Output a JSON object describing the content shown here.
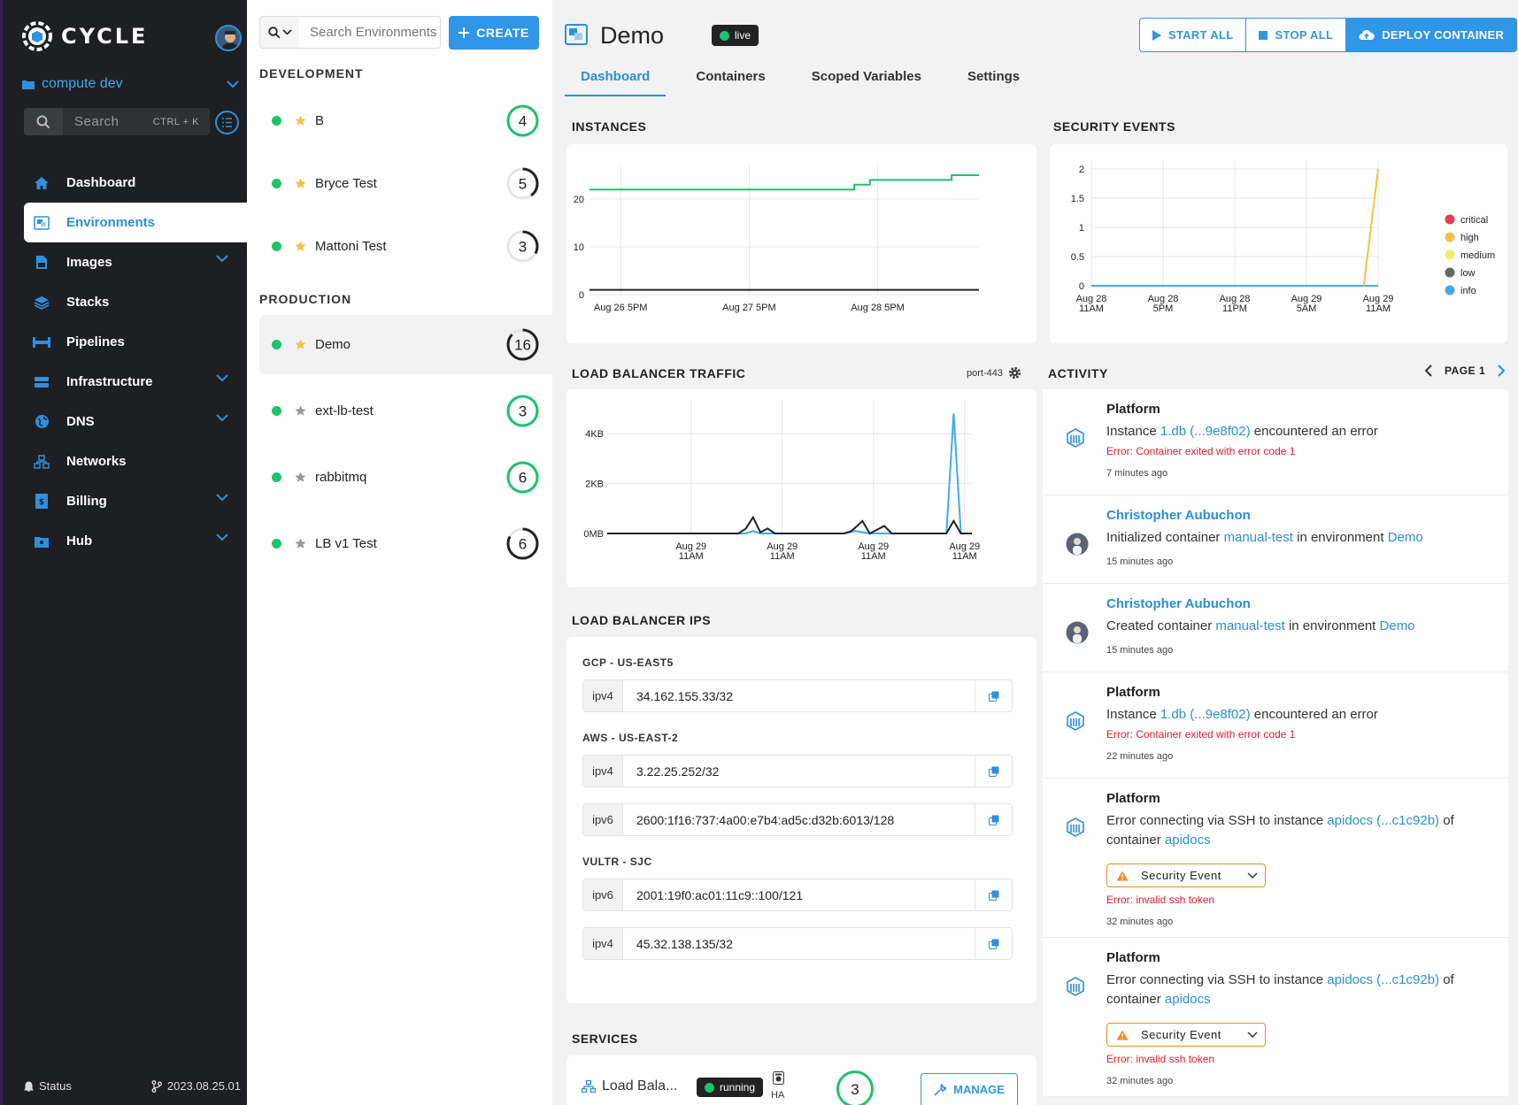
{
  "sidebar": {
    "brand": "CYCLE",
    "hub": "compute dev",
    "search_placeholder": "Search",
    "search_shortcut": "CTRL + K",
    "items": [
      {
        "label": "Dashboard",
        "icon": "home-icon"
      },
      {
        "label": "Environments",
        "icon": "environments-icon",
        "active": true
      },
      {
        "label": "Images",
        "icon": "images-icon"
      },
      {
        "label": "Stacks",
        "icon": "stacks-icon"
      },
      {
        "label": "Pipelines",
        "icon": "pipelines-icon"
      },
      {
        "label": "Infrastructure",
        "icon": "infrastructure-icon"
      },
      {
        "label": "DNS",
        "icon": "globe-icon"
      },
      {
        "label": "Networks",
        "icon": "networks-icon"
      },
      {
        "label": "Billing",
        "icon": "billing-icon"
      },
      {
        "label": "Hub",
        "icon": "hub-icon"
      }
    ],
    "status_label": "Status",
    "version": "2023.08.25.01"
  },
  "envlist": {
    "search_placeholder": "Search Environments",
    "create_label": "CREATE",
    "groups": {
      "development": "DEVELOPMENT",
      "production": "PRODUCTION"
    },
    "development": [
      {
        "name": "B",
        "count": "4",
        "fill": 1.0
      },
      {
        "name": "Bryce Test",
        "count": "5",
        "fill": 0.4
      },
      {
        "name": "Mattoni Test",
        "count": "3",
        "fill": 0.33
      }
    ],
    "production": [
      {
        "name": "Demo",
        "count": "16",
        "fill": 0.87
      },
      {
        "name": "ext-lb-test",
        "count": "3",
        "fill": 1.0
      },
      {
        "name": "rabbitmq",
        "count": "6",
        "fill": 1.0
      },
      {
        "name": "LB v1 Test",
        "count": "6",
        "fill": 0.83
      }
    ]
  },
  "main": {
    "title": "Demo",
    "state": "live",
    "actions": {
      "start": "START ALL",
      "stop": "STOP ALL",
      "deploy": "DEPLOY CONTAINER"
    },
    "tabs": [
      "Dashboard",
      "Containers",
      "Scoped Variables",
      "Settings"
    ],
    "sections": {
      "instances": "INSTANCES",
      "security": "SECURITY EVENTS",
      "traffic": "LOAD BALANCER TRAFFIC",
      "traffic_port": "port-443",
      "ips": "LOAD BALANCER IPS",
      "services": "SERVICES",
      "activity": "ACTIVITY",
      "page": "PAGE 1"
    },
    "ips": {
      "groups": [
        {
          "name": "GCP - US-EAST5",
          "rows": [
            {
              "type": "ipv4",
              "addr": "34.162.155.33/32"
            }
          ]
        },
        {
          "name": "AWS - US-EAST-2",
          "rows": [
            {
              "type": "ipv4",
              "addr": "3.22.25.252/32"
            },
            {
              "type": "ipv6",
              "addr": "2600:1f16:737:4a00:e7b4:ad5c:d32b:6013/128"
            }
          ]
        },
        {
          "name": "VULTR - SJC",
          "rows": [
            {
              "type": "ipv6",
              "addr": "2001:19f0:ac01:11c9::100/121"
            },
            {
              "type": "ipv4",
              "addr": "45.32.138.135/32"
            }
          ]
        }
      ]
    },
    "service": {
      "name": "Load Bala...",
      "state": "running",
      "ha": "HA",
      "count": "3",
      "manage": "MANAGE"
    }
  },
  "activity": [
    {
      "source": "Platform",
      "pre": "Instance ",
      "link1": "1.db (...9e8f02)",
      "mid": " encountered an error",
      "link2": "",
      "mid2": "",
      "link3": "",
      "error": "Error: Container exited with error code 1",
      "time": "7 minutes ago"
    },
    {
      "source": "Christopher Aubuchon",
      "pre": "Initialized container ",
      "link1": "manual-test",
      "mid": " in environment ",
      "link2": "Demo",
      "mid2": "",
      "link3": "",
      "error": "",
      "time": "15 minutes ago"
    },
    {
      "source": "Christopher Aubuchon",
      "pre": "Created container ",
      "link1": "manual-test",
      "mid": " in environment ",
      "link2": "Demo",
      "mid2": "",
      "link3": "",
      "error": "",
      "time": "15 minutes ago"
    },
    {
      "source": "Platform",
      "pre": "Instance ",
      "link1": "1.db (...9e8f02)",
      "mid": " encountered an error",
      "link2": "",
      "mid2": "",
      "link3": "",
      "error": "Error: Container exited with error code 1",
      "time": "22 minutes ago"
    },
    {
      "source": "Platform",
      "pre": "Error connecting via SSH to instance ",
      "link1": "apidocs (...c1c92b)",
      "mid": " of container ",
      "link2": "apidocs",
      "mid2": "",
      "link3": "",
      "badge": "Security Event",
      "error": "Error: invalid ssh token",
      "time": "32 minutes ago"
    },
    {
      "source": "Platform",
      "pre": "Error connecting via SSH to instance ",
      "link1": "apidocs (...c1c92b)",
      "mid": " of container ",
      "link2": "apidocs",
      "mid2": "",
      "link3": "",
      "badge": "Security Event",
      "error": "Error: invalid ssh token",
      "time": "32 minutes ago"
    }
  ],
  "chart_data": [
    {
      "type": "line",
      "title": "INSTANCES",
      "x_ticks": [
        "Aug 26 5PM",
        "Aug 27 5PM",
        "Aug 28 5PM"
      ],
      "y_ticks": [
        0,
        10,
        20
      ],
      "ylim": [
        0,
        25
      ],
      "series": [
        {
          "color": "#1fc26b",
          "points": [
            [
              0,
              22
            ],
            [
              0.68,
              22
            ],
            [
              0.68,
              23
            ],
            [
              0.72,
              23
            ],
            [
              0.72,
              24
            ],
            [
              0.93,
              24
            ],
            [
              0.93,
              25
            ],
            [
              1.0,
              25
            ]
          ]
        },
        {
          "color": "#222222",
          "points": [
            [
              0,
              1
            ],
            [
              1,
              1
            ]
          ]
        }
      ]
    },
    {
      "type": "line",
      "title": "SECURITY EVENTS",
      "x_ticks": [
        "Aug 28 11AM",
        "Aug 28 5PM",
        "Aug 28 11PM",
        "Aug 29 5AM",
        "Aug 29 11AM"
      ],
      "y_ticks": [
        0,
        0.5,
        1,
        1.5,
        2
      ],
      "ylim": [
        0,
        2
      ],
      "legend": [
        {
          "name": "critical",
          "color": "#e04050"
        },
        {
          "name": "high",
          "color": "#f5c242"
        },
        {
          "name": "medium",
          "color": "#f2ef6a"
        },
        {
          "name": "low",
          "color": "#666666"
        },
        {
          "name": "info",
          "color": "#40a9f2"
        }
      ],
      "series": [
        {
          "color": "#40a9f2",
          "points": [
            [
              0,
              0
            ],
            [
              1,
              0
            ]
          ]
        },
        {
          "color": "#f5c242",
          "points": [
            [
              0.95,
              0
            ],
            [
              1.0,
              2
            ]
          ]
        }
      ]
    },
    {
      "type": "line",
      "title": "LOAD BALANCER TRAFFIC",
      "x_ticks": [
        "Aug 29 11AM",
        "Aug 29 11AM",
        "Aug 29 11AM",
        "Aug 29 11AM"
      ],
      "y_ticks": [
        "0MB",
        "2KB",
        "4KB"
      ],
      "y_values": [
        0,
        2,
        4
      ],
      "ylim": [
        0,
        5
      ],
      "series": [
        {
          "color": "#40a9f2",
          "points": [
            [
              0,
              0
            ],
            [
              0.38,
              0
            ],
            [
              0.4,
              0.1
            ],
            [
              0.42,
              0
            ],
            [
              0.65,
              0
            ],
            [
              0.68,
              0.1
            ],
            [
              0.72,
              0
            ],
            [
              0.93,
              0
            ],
            [
              0.95,
              4.8
            ],
            [
              0.97,
              0
            ],
            [
              1,
              0
            ]
          ]
        },
        {
          "color": "#222222",
          "points": [
            [
              0,
              0
            ],
            [
              0.36,
              0
            ],
            [
              0.38,
              0.2
            ],
            [
              0.4,
              0.65
            ],
            [
              0.42,
              0.05
            ],
            [
              0.44,
              0.2
            ],
            [
              0.46,
              0
            ],
            [
              0.65,
              0
            ],
            [
              0.67,
              0.1
            ],
            [
              0.7,
              0.5
            ],
            [
              0.72,
              0
            ],
            [
              0.76,
              0.3
            ],
            [
              0.78,
              0
            ],
            [
              0.93,
              0
            ],
            [
              0.95,
              0.5
            ],
            [
              0.97,
              0
            ],
            [
              1,
              0
            ]
          ]
        }
      ]
    }
  ]
}
